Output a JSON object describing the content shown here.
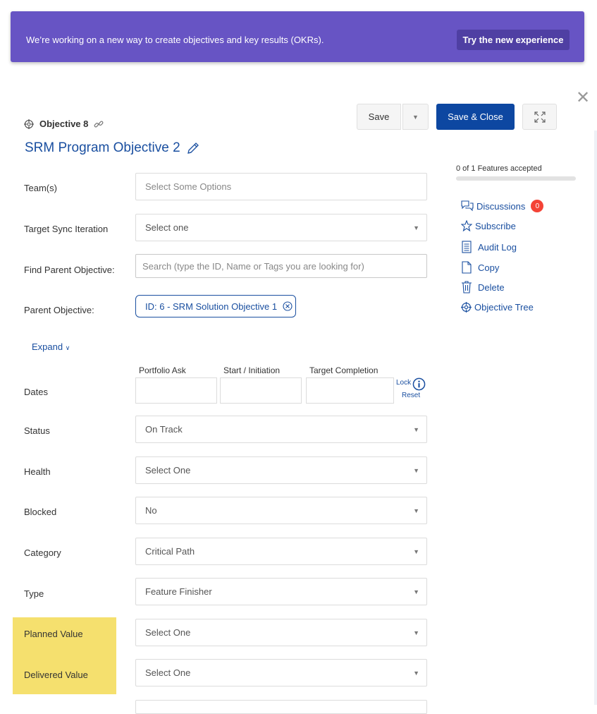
{
  "banner": {
    "message": "We’re working on a new way to create objectives and key results (OKRs).",
    "button_label": "Try the new experience",
    "bg_color": "#6754c4"
  },
  "toolbar": {
    "save_label": "Save",
    "save_close_label": "Save & Close",
    "close_glyph": "✕"
  },
  "objective": {
    "id_label": "Objective 8",
    "title": "SRM Program Objective 2"
  },
  "form": {
    "teams": {
      "label": "Team(s)",
      "placeholder": "Select Some Options"
    },
    "target_sync": {
      "label": "Target Sync Iteration",
      "value": "Select one"
    },
    "find_parent": {
      "label": "Find Parent Objective:",
      "placeholder": "Search (type the ID, Name or Tags you are looking for)"
    },
    "parent": {
      "label": "Parent Objective:",
      "chip": "ID: 6 - SRM Solution Objective 1"
    },
    "expand_label": "Expand",
    "dates": {
      "label": "Dates",
      "col_portfolio": "Portfolio Ask",
      "col_start": "Start / Initiation",
      "col_target": "Target Completion",
      "lock": "Lock",
      "reset": "Reset"
    },
    "status": {
      "label": "Status",
      "value": "On Track"
    },
    "health": {
      "label": "Health",
      "value": "Select One"
    },
    "blocked": {
      "label": "Blocked",
      "value": "No"
    },
    "category": {
      "label": "Category",
      "value": "Critical Path"
    },
    "type": {
      "label": "Type",
      "value": "Feature Finisher"
    },
    "planned_value": {
      "label": "Planned Value",
      "value": "Select One"
    },
    "delivered_value": {
      "label": "Delivered Value",
      "value": "Select One"
    }
  },
  "sidebar": {
    "progress_text": "0 of 1 Features accepted",
    "progress_fraction": 0,
    "items": [
      {
        "label": "Discussions",
        "icon": "discussion-icon",
        "badge": "0"
      },
      {
        "label": "Subscribe",
        "icon": "star-icon"
      },
      {
        "label": "Audit Log",
        "icon": "audit-log-icon"
      },
      {
        "label": "Copy",
        "icon": "copy-icon"
      },
      {
        "label": "Delete",
        "icon": "trash-icon"
      },
      {
        "label": "Objective Tree",
        "icon": "crosshair-icon"
      }
    ]
  },
  "colors": {
    "accent": "#1a4fa0",
    "primary_button": "#0d47a1",
    "highlight": "#f5e06e",
    "badge": "#f44336"
  }
}
